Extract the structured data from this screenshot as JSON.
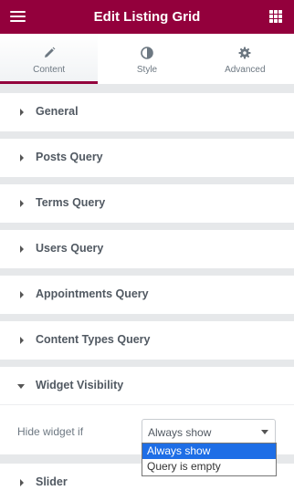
{
  "header": {
    "title": "Edit Listing Grid",
    "menu_icon": "hamburger-icon",
    "widgets_icon": "grid-icon"
  },
  "tabs": [
    {
      "label": "Content",
      "icon": "pencil-icon",
      "active": true
    },
    {
      "label": "Style",
      "icon": "half-circle-icon",
      "active": false
    },
    {
      "label": "Advanced",
      "icon": "gear-icon",
      "active": false
    }
  ],
  "sections": [
    {
      "label": "General",
      "open": false
    },
    {
      "label": "Posts Query",
      "open": false
    },
    {
      "label": "Terms Query",
      "open": false
    },
    {
      "label": "Users Query",
      "open": false
    },
    {
      "label": "Appointments Query",
      "open": false
    },
    {
      "label": "Content Types Query",
      "open": false
    },
    {
      "label": "Widget Visibility",
      "open": true
    },
    {
      "label": "Slider",
      "open": false
    }
  ],
  "visibility": {
    "field_label": "Hide widget if",
    "selected_value": "Always show",
    "options": [
      "Always show",
      "Query is empty"
    ]
  },
  "colors": {
    "brand": "#93003c",
    "highlight": "#1e6ee6"
  }
}
